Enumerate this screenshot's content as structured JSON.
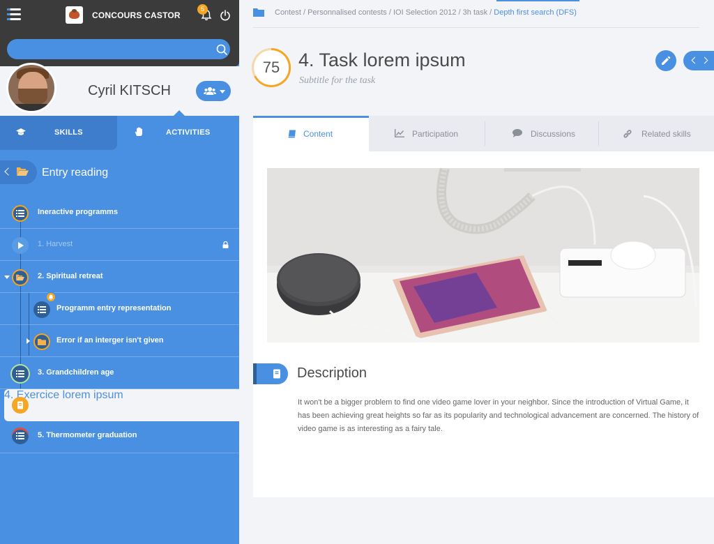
{
  "app": {
    "logo_text": "CONCOURS CASTOR",
    "notification_count": "5"
  },
  "search": {
    "placeholder": ""
  },
  "user": {
    "name": "Cyril KITSCH"
  },
  "sidebar": {
    "tabs": [
      {
        "label": "SKILLS"
      },
      {
        "label": "ACTIVITIES"
      }
    ],
    "section_title": "Entry reading",
    "items": [
      {
        "label": "Ineractive programms"
      },
      {
        "label": "1. Harvest"
      },
      {
        "label": "2. Spiritual retreat"
      },
      {
        "label": "Programm entry representation"
      },
      {
        "label": "Error if an interger isn't given"
      },
      {
        "label": "3. Grandchildren age"
      },
      {
        "label": "4. Exercice lorem ipsum"
      },
      {
        "label": "5. Thermometer graduation"
      }
    ]
  },
  "breadcrumb": {
    "path": "Contest / Personnalised contests / IOI Selection 2012 / 3h task / ",
    "current": "Depth first search (DFS)"
  },
  "task": {
    "score": "75",
    "title": "4. Task lorem ipsum",
    "subtitle": "Subtitle for the task"
  },
  "content_tabs": [
    {
      "label": "Content"
    },
    {
      "label": "Participation"
    },
    {
      "label": "Discussions"
    },
    {
      "label": "Related skills"
    }
  ],
  "description": {
    "title": "Description",
    "text": "It won't be a bigger problem to find one video game lover in your neighbor. Since the introduction of Virtual Game, it has been achieving great heights so far as its popularity and technological advancement are concerned. The history of video game is as interesting as a fairy tale."
  }
}
